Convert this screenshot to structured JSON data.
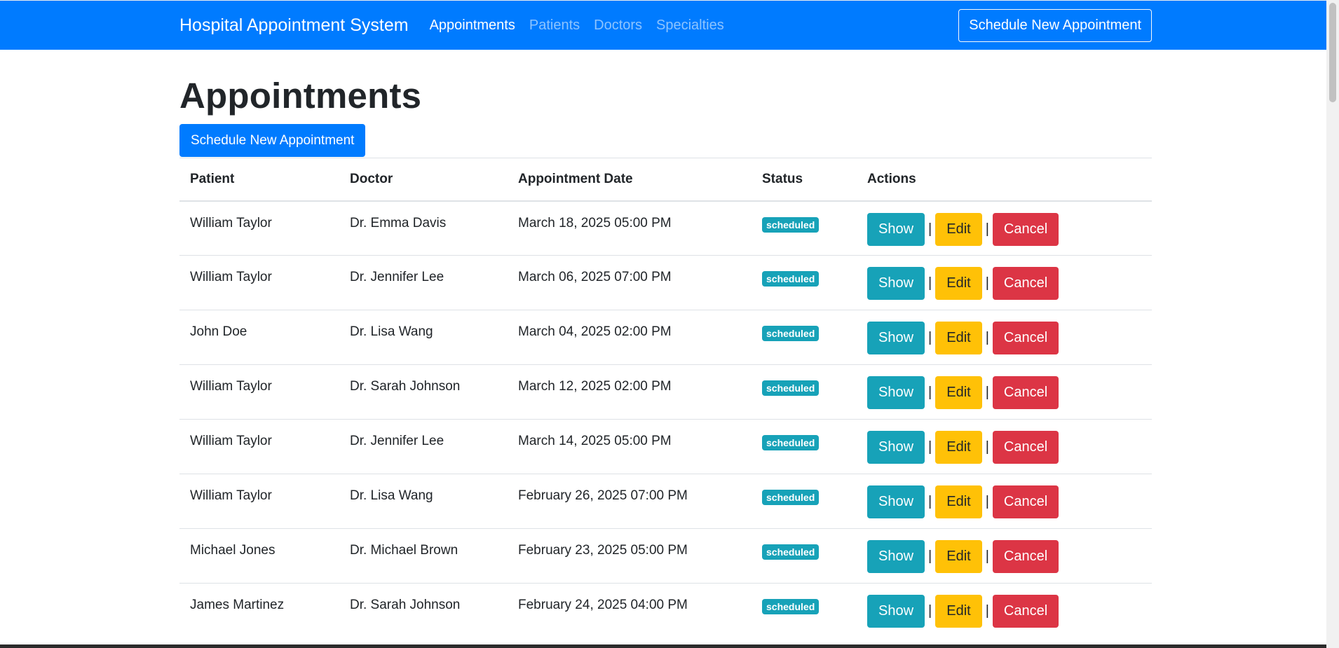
{
  "navbar": {
    "brand": "Hospital Appointment System",
    "links": [
      {
        "label": "Appointments",
        "active": true
      },
      {
        "label": "Patients",
        "active": false
      },
      {
        "label": "Doctors",
        "active": false
      },
      {
        "label": "Specialties",
        "active": false
      }
    ],
    "cta_label": "Schedule New Appointment"
  },
  "main": {
    "title": "Appointments",
    "new_button_label": "Schedule New Appointment"
  },
  "table": {
    "headers": {
      "patient": "Patient",
      "doctor": "Doctor",
      "date": "Appointment Date",
      "status": "Status",
      "actions": "Actions"
    },
    "rows": [
      {
        "patient": "William Taylor",
        "doctor": "Dr. Emma Davis",
        "date": "March 18, 2025 05:00 PM",
        "status": "scheduled"
      },
      {
        "patient": "William Taylor",
        "doctor": "Dr. Jennifer Lee",
        "date": "March 06, 2025 07:00 PM",
        "status": "scheduled"
      },
      {
        "patient": "John Doe",
        "doctor": "Dr. Lisa Wang",
        "date": "March 04, 2025 02:00 PM",
        "status": "scheduled"
      },
      {
        "patient": "William Taylor",
        "doctor": "Dr. Sarah Johnson",
        "date": "March 12, 2025 02:00 PM",
        "status": "scheduled"
      },
      {
        "patient": "William Taylor",
        "doctor": "Dr. Jennifer Lee",
        "date": "March 14, 2025 05:00 PM",
        "status": "scheduled"
      },
      {
        "patient": "William Taylor",
        "doctor": "Dr. Lisa Wang",
        "date": "February 26, 2025 07:00 PM",
        "status": "scheduled"
      },
      {
        "patient": "Michael Jones",
        "doctor": "Dr. Michael Brown",
        "date": "February 23, 2025 05:00 PM",
        "status": "scheduled"
      },
      {
        "patient": "James Martinez",
        "doctor": "Dr. Sarah Johnson",
        "date": "February 24, 2025 04:00 PM",
        "status": "scheduled"
      }
    ],
    "actions": {
      "show": "Show",
      "edit": "Edit",
      "cancel": "Cancel",
      "separator": "|"
    }
  },
  "colors": {
    "primary": "#007bff",
    "info": "#17a2b8",
    "warning": "#ffc107",
    "danger": "#dc3545"
  }
}
